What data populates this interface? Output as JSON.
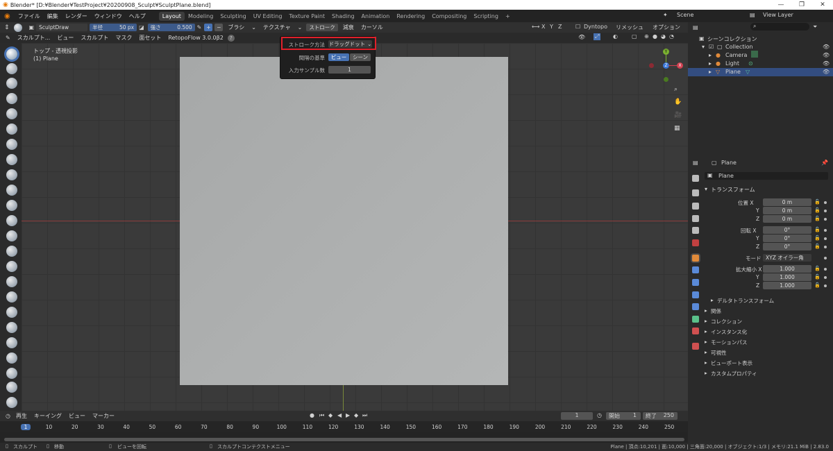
{
  "window": {
    "title": "Blender* [D:¥Blender¥TestProject¥20200908_Sculpt¥SculptPlane.blend]",
    "min": "—",
    "max": "❐",
    "close": "✕"
  },
  "menu": {
    "items": [
      "ファイル",
      "編集",
      "レンダー",
      "ウィンドウ",
      "ヘルプ"
    ]
  },
  "workspaces": [
    "Layout",
    "Modeling",
    "Sculpting",
    "UV Editing",
    "Texture Paint",
    "Shading",
    "Animation",
    "Rendering",
    "Compositing",
    "Scripting",
    "+"
  ],
  "scene": {
    "scene": "Scene",
    "view_layer": "View Layer"
  },
  "header1": {
    "brush_name": "SculptDraw",
    "radius_label": "半径",
    "radius_value": "50 px",
    "strength_label": "強さ",
    "strength_value": "0.500",
    "plus": "+",
    "minus": "−",
    "brush": "ブラシ",
    "texture": "テクスチャ",
    "stroke": "ストローク",
    "falloff": "減衰",
    "cursor": "カーソル",
    "x": "X",
    "y": "Y",
    "z": "Z",
    "dyntopo": "Dyntopo",
    "remesh": "リメッシュ",
    "options": "オプション"
  },
  "header2": {
    "mode": "スカルプト...",
    "view": "ビュー",
    "sculpt": "スカルプト",
    "mask": "マスク",
    "face_set": "面セット",
    "retopo": "RetopoFlow 3.0.0β2",
    "help": "?"
  },
  "viewport": {
    "view_name": "トップ - 透視投影",
    "object": "(1) Plane",
    "gizmo_y": "Y",
    "gizmo_z": "Z",
    "gizmo_x": "X"
  },
  "popup": {
    "stroke_method_label": "ストローク方法",
    "stroke_method_value": "ドラッグドット",
    "spacing_label": "間隔の基準",
    "spacing_view": "ビュー",
    "spacing_scene": "シーン",
    "samples_label": "入力サンプル数",
    "samples_value": "1"
  },
  "outliner": {
    "title": "シーンコレクション",
    "collection": "Collection",
    "items": [
      "Camera",
      "Light",
      "Plane"
    ]
  },
  "properties": {
    "object_name": "Plane",
    "object_field": "Plane",
    "transform": "トランスフォーム",
    "location_label": "位置 X",
    "loc": [
      "0 m",
      "0 m",
      "0 m"
    ],
    "rotation_label": "回転 X",
    "rot": [
      "0°",
      "0°",
      "0°"
    ],
    "mode_label": "モード",
    "mode_value": "XYZ オイラー角",
    "scale_label": "拡大縮小 X",
    "scale": [
      "1.000",
      "1.000",
      "1.000"
    ],
    "y": "Y",
    "z": "Z",
    "delta": "デルタトランスフォーム",
    "sections": [
      "関係",
      "コレクション",
      "インスタンス化",
      "モーションパス",
      "可視性",
      "ビューポート表示",
      "カスタムプロパティ"
    ]
  },
  "timeline": {
    "play": "再生",
    "keying": "キーイング",
    "view": "ビュー",
    "marker": "マーカー",
    "current": "1",
    "start_label": "開始",
    "start": "1",
    "end_label": "終了",
    "end": "250",
    "ticks": [
      "1",
      "10",
      "20",
      "30",
      "40",
      "50",
      "60",
      "70",
      "80",
      "90",
      "100",
      "110",
      "120",
      "130",
      "140",
      "150",
      "160",
      "170",
      "180",
      "190",
      "200",
      "210",
      "220",
      "230",
      "240",
      "250"
    ]
  },
  "status": {
    "left1": "スカルプト",
    "left2": "移動",
    "left3": "ビューを回転",
    "left4": "スカルプトコンテクストメニュー",
    "right": "Plane | 頂点:10,201 | 面:10,000 | 三角面:20,000 | オブジェクト:1/3 | メモリ:21.1 MiB | 2.83.0"
  }
}
